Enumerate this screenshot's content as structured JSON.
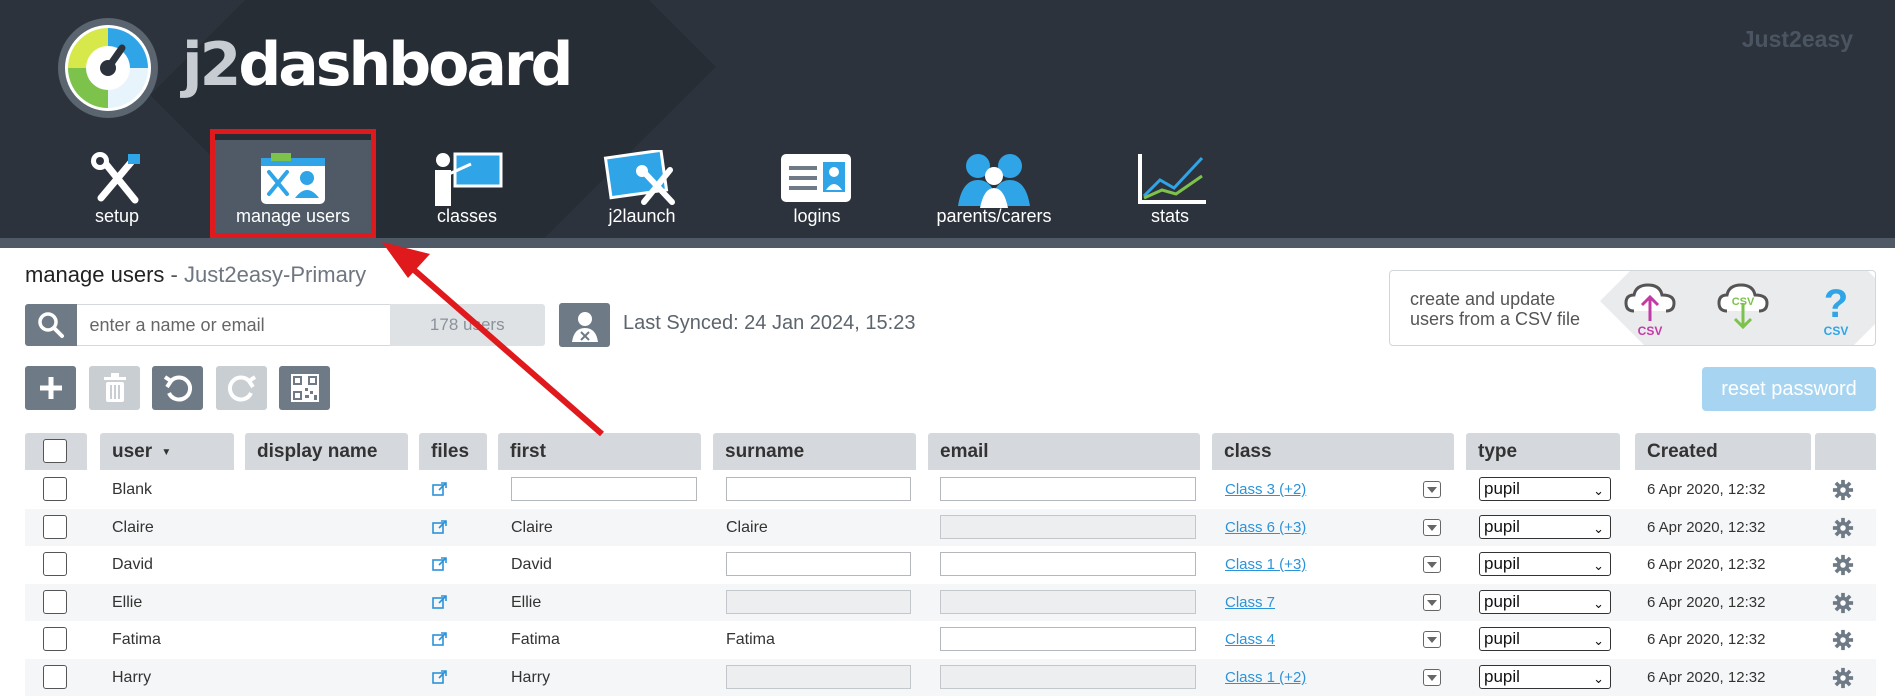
{
  "header": {
    "logo_prefix": "j2",
    "logo_suffix": "dashboard",
    "brand_right": "Just2easy"
  },
  "nav": {
    "items": [
      {
        "label": "setup",
        "icon": "tools-icon"
      },
      {
        "label": "manage users",
        "icon": "id-card-tools-icon",
        "active": true
      },
      {
        "label": "classes",
        "icon": "teacher-board-icon"
      },
      {
        "label": "j2launch",
        "icon": "launch-tools-icon"
      },
      {
        "label": "logins",
        "icon": "id-card-icon"
      },
      {
        "label": "parents/carers",
        "icon": "people-icon"
      },
      {
        "label": "stats",
        "icon": "line-chart-icon"
      }
    ]
  },
  "page": {
    "title": "manage users",
    "separator": "-",
    "school": "Just2easy-Primary"
  },
  "search": {
    "placeholder": "enter a name or email",
    "user_count": "178 users"
  },
  "sync": {
    "text": "Last Synced: 24 Jan 2024, 15:23"
  },
  "csv": {
    "line1": "create and update",
    "line2": "users from a CSV file",
    "upload_label": "CSV",
    "download_label": "CSV",
    "help_label": "CSV"
  },
  "toolbar": {
    "reset_password": "reset password"
  },
  "table": {
    "headers": {
      "user": "user",
      "sort_indicator": "▼",
      "display_name": "display name",
      "files": "files",
      "first": "first",
      "surname": "surname",
      "email": "email",
      "class": "class",
      "type": "type",
      "created": "Created"
    },
    "rows": [
      {
        "user": "Blank",
        "display": "",
        "first": "",
        "surname": "",
        "class": "Class 3 (+2)",
        "type": "pupil",
        "created": "6 Apr 2020, 12:32"
      },
      {
        "user": "Claire",
        "display": "",
        "first": "Claire",
        "surname": "Claire",
        "class": "Class 6 (+3)",
        "type": "pupil",
        "created": "6 Apr 2020, 12:32"
      },
      {
        "user": "David",
        "display": "",
        "first": "David",
        "surname": "",
        "class": "Class 1 (+3)",
        "type": "pupil",
        "created": "6 Apr 2020, 12:32"
      },
      {
        "user": "Ellie",
        "display": "",
        "first": "Ellie",
        "surname": "",
        "class": "Class 7",
        "type": "pupil",
        "created": "6 Apr 2020, 12:32"
      },
      {
        "user": "Fatima",
        "display": "",
        "first": "Fatima",
        "surname": "Fatima",
        "class": "Class 4",
        "type": "pupil",
        "created": "6 Apr 2020, 12:32"
      },
      {
        "user": "Harry",
        "display": "",
        "first": "Harry",
        "surname": "",
        "class": "Class 1 (+2)",
        "type": "pupil",
        "created": "6 Apr 2020, 12:32"
      }
    ]
  },
  "colors": {
    "header_bg": "#2c333c",
    "highlight": "#e0191c",
    "link": "#2d93d8",
    "reset_button": "#a7d4f1"
  }
}
